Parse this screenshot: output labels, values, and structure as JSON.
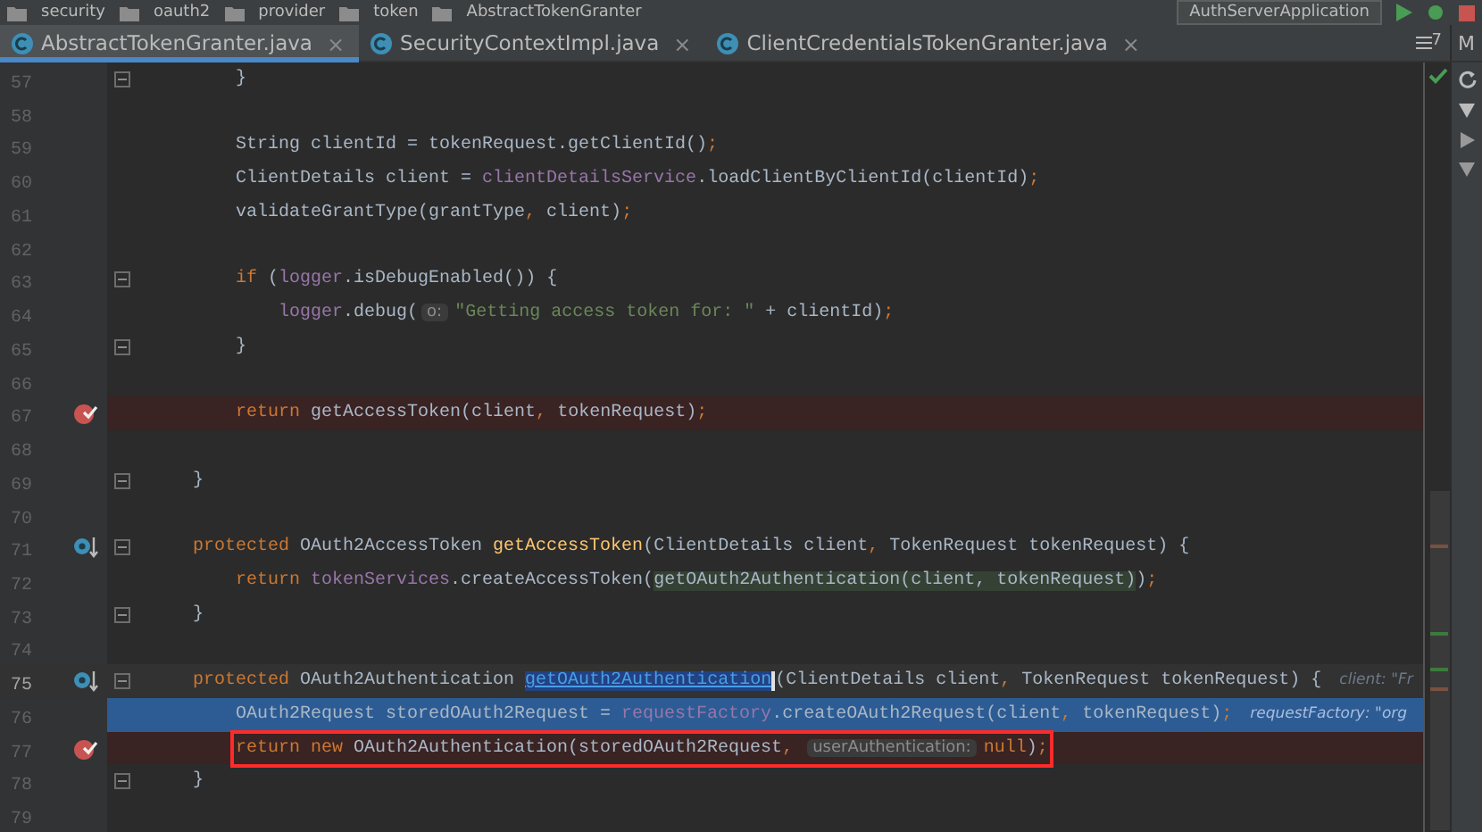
{
  "breadcrumb": {
    "items": [
      "security",
      "oauth2",
      "provider",
      "token",
      "AbstractTokenGranter"
    ],
    "run_config": "AuthServerApplication"
  },
  "tabs": [
    {
      "label": "AbstractTokenGranter.java",
      "selected": true,
      "close": "×"
    },
    {
      "label": "SecurityContextImpl.java",
      "selected": false,
      "close": "×"
    },
    {
      "label": "ClientCredentialsTokenGranter.java",
      "selected": false,
      "close": "×"
    }
  ],
  "tab_overflow": "7",
  "side_panel_label": "M",
  "lines": [
    {
      "number": "57",
      "breakpoint": false,
      "override": false,
      "fold": true,
      "current": false,
      "execution": false,
      "boxed": false,
      "tokens": [
        {
          "kind": "plain",
          "text": "        }"
        }
      ]
    },
    {
      "number": "58",
      "breakpoint": false,
      "override": false,
      "fold": false,
      "current": false,
      "execution": false,
      "boxed": false
    },
    {
      "number": "59",
      "breakpoint": false,
      "override": false,
      "fold": false,
      "current": false,
      "execution": false,
      "boxed": false,
      "tokens": [
        {
          "kind": "plain",
          "text": "        String clientId = tokenRequest.getClientId()"
        },
        {
          "kind": "punct",
          "text": ";"
        }
      ]
    },
    {
      "number": "60",
      "breakpoint": false,
      "override": false,
      "fold": false,
      "current": false,
      "execution": false,
      "boxed": false,
      "tokens": [
        {
          "kind": "plain",
          "text": "        ClientDetails client = "
        },
        {
          "kind": "field",
          "text": "clientDetailsService"
        },
        {
          "kind": "plain",
          "text": ".loadClientByClientId(clientId)"
        },
        {
          "kind": "punct",
          "text": ";"
        }
      ]
    },
    {
      "number": "61",
      "breakpoint": false,
      "override": false,
      "fold": false,
      "current": false,
      "execution": false,
      "boxed": false,
      "tokens": [
        {
          "kind": "plain",
          "text": "        validateGrantType(grantType"
        },
        {
          "kind": "punct",
          "text": ", "
        },
        {
          "kind": "plain",
          "text": "client)"
        },
        {
          "kind": "punct",
          "text": ";"
        }
      ]
    },
    {
      "number": "62",
      "breakpoint": false,
      "override": false,
      "fold": false,
      "current": false,
      "execution": false,
      "boxed": false
    },
    {
      "number": "63",
      "breakpoint": false,
      "override": false,
      "fold": true,
      "current": false,
      "execution": false,
      "boxed": false,
      "tokens": [
        {
          "kind": "keyword",
          "text": "        if"
        },
        {
          "kind": "plain",
          "text": " ("
        },
        {
          "kind": "field",
          "text": "logger"
        },
        {
          "kind": "plain",
          "text": ".isDebugEnabled()) {"
        }
      ]
    },
    {
      "number": "64",
      "breakpoint": false,
      "override": false,
      "fold": false,
      "current": false,
      "execution": false,
      "boxed": false,
      "tokens": [
        {
          "kind": "field",
          "text": "            logger"
        },
        {
          "kind": "plain",
          "text": ".debug("
        },
        {
          "kind": "hint",
          "text": "o:"
        },
        {
          "kind": "string",
          "text": "\"Getting access token for: \""
        },
        {
          "kind": "plain",
          "text": " + clientId)"
        },
        {
          "kind": "punct",
          "text": ";"
        }
      ]
    },
    {
      "number": "65",
      "breakpoint": false,
      "override": false,
      "fold": true,
      "current": false,
      "execution": false,
      "boxed": false,
      "tokens": [
        {
          "kind": "plain",
          "text": "        }"
        }
      ]
    },
    {
      "number": "66",
      "breakpoint": false,
      "override": false,
      "fold": false,
      "current": false,
      "execution": false,
      "boxed": false
    },
    {
      "number": "67",
      "breakpoint": true,
      "override": false,
      "fold": false,
      "current": false,
      "execution": false,
      "boxed": false,
      "tokens": [
        {
          "kind": "keyword",
          "text": "        return"
        },
        {
          "kind": "plain",
          "text": " getAccessToken(client"
        },
        {
          "kind": "punct",
          "text": ", "
        },
        {
          "kind": "plain",
          "text": "tokenRequest)"
        },
        {
          "kind": "punct",
          "text": ";"
        }
      ]
    },
    {
      "number": "68",
      "breakpoint": false,
      "override": false,
      "fold": false,
      "current": false,
      "execution": false,
      "boxed": false
    },
    {
      "number": "69",
      "breakpoint": false,
      "override": false,
      "fold": true,
      "current": false,
      "execution": false,
      "boxed": false,
      "tokens": [
        {
          "kind": "plain",
          "text": "    }"
        }
      ]
    },
    {
      "number": "70",
      "breakpoint": false,
      "override": false,
      "fold": false,
      "current": false,
      "execution": false,
      "boxed": false
    },
    {
      "number": "71",
      "breakpoint": false,
      "override": true,
      "fold": true,
      "current": false,
      "execution": false,
      "boxed": false,
      "tokens": [
        {
          "kind": "keyword",
          "text": "    protected"
        },
        {
          "kind": "plain",
          "text": " OAuth2AccessToken "
        },
        {
          "kind": "declaration",
          "text": "getAccessToken"
        },
        {
          "kind": "plain",
          "text": "(ClientDetails client"
        },
        {
          "kind": "punct",
          "text": ", "
        },
        {
          "kind": "plain",
          "text": "TokenRequest tokenRequest) {"
        }
      ]
    },
    {
      "number": "72",
      "breakpoint": false,
      "override": false,
      "fold": false,
      "current": false,
      "execution": false,
      "boxed": false,
      "tokens": [
        {
          "kind": "keyword",
          "text": "        return "
        },
        {
          "kind": "field",
          "text": "tokenServices"
        },
        {
          "kind": "plain",
          "text": ".createAccessToken("
        },
        {
          "kind": "usage",
          "text": "getOAuth2Authentication(client, tokenRequest)"
        },
        {
          "kind": "plain",
          "text": ")"
        },
        {
          "kind": "punct",
          "text": ";"
        }
      ]
    },
    {
      "number": "73",
      "breakpoint": false,
      "override": false,
      "fold": true,
      "current": false,
      "execution": false,
      "boxed": false,
      "tokens": [
        {
          "kind": "plain",
          "text": "    }"
        }
      ]
    },
    {
      "number": "74",
      "breakpoint": false,
      "override": false,
      "fold": false,
      "current": false,
      "execution": false,
      "boxed": false
    },
    {
      "number": "75",
      "breakpoint": false,
      "override": true,
      "fold": true,
      "current": true,
      "execution": false,
      "boxed": false,
      "tokens": [
        {
          "kind": "keyword",
          "text": "    protected"
        },
        {
          "kind": "plain",
          "text": " OAuth2Authentication "
        },
        {
          "kind": "selection",
          "text": "getOAuth2Authentication"
        },
        {
          "kind": "plain",
          "text": "(ClientDetails client"
        },
        {
          "kind": "punct",
          "text": ", "
        },
        {
          "kind": "plain",
          "text": "TokenRequest tokenRequest) {"
        },
        {
          "kind": "inlay",
          "text": "client: \"Fr"
        }
      ]
    },
    {
      "number": "76",
      "breakpoint": false,
      "override": false,
      "fold": false,
      "current": false,
      "execution": true,
      "boxed": false,
      "tokens": [
        {
          "kind": "plain",
          "text": "        OAuth2Request storedOAuth2Request = "
        },
        {
          "kind": "field",
          "text": "requestFactory"
        },
        {
          "kind": "plain",
          "text": ".createOAuth2Request(client"
        },
        {
          "kind": "punct",
          "text": ", "
        },
        {
          "kind": "plain",
          "text": "tokenRequest)"
        },
        {
          "kind": "punct",
          "text": ";"
        },
        {
          "kind": "inlay",
          "text": "requestFactory: \"org"
        }
      ]
    },
    {
      "number": "77",
      "breakpoint": true,
      "override": false,
      "fold": false,
      "current": false,
      "execution": false,
      "boxed": true,
      "tokens": [
        {
          "kind": "keyword",
          "text": "        return new"
        },
        {
          "kind": "plain",
          "text": " OAuth2Authentication(storedOAuth2Request"
        },
        {
          "kind": "punct",
          "text": ", "
        },
        {
          "kind": "hint",
          "text": "userAuthentication:"
        },
        {
          "kind": "keyword",
          "text": "null"
        },
        {
          "kind": "plain",
          "text": ")"
        },
        {
          "kind": "punct",
          "text": ";"
        }
      ]
    },
    {
      "number": "78",
      "breakpoint": false,
      "override": false,
      "fold": true,
      "current": false,
      "execution": false,
      "boxed": false,
      "tokens": [
        {
          "kind": "plain",
          "text": "    }"
        }
      ]
    },
    {
      "number": "79",
      "breakpoint": false,
      "override": false,
      "fold": false,
      "current": false,
      "execution": false,
      "boxed": false
    }
  ]
}
